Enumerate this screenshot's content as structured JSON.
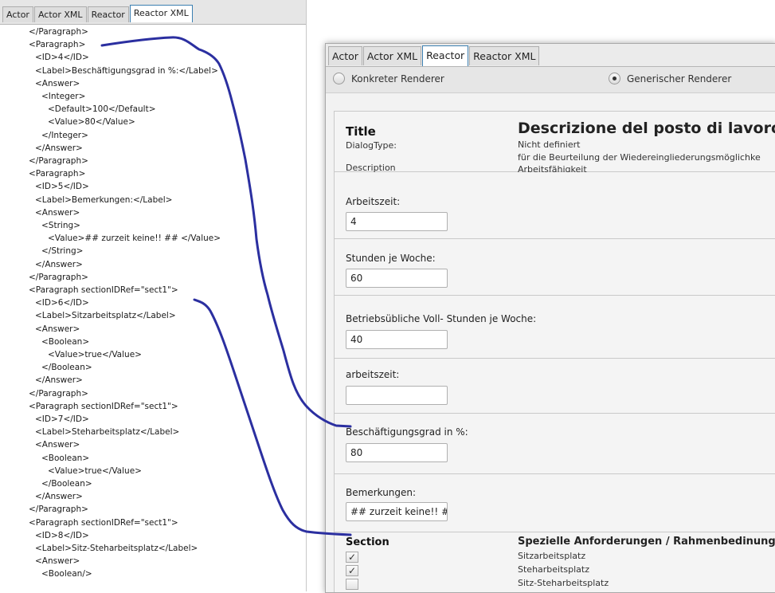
{
  "left_panel": {
    "tabs": [
      "Actor",
      "Actor XML",
      "Reactor",
      "Reactor XML"
    ],
    "active_tab": "Reactor XML",
    "xml_lines": [
      {
        "indent": 0,
        "text": "</Paragraph>"
      },
      {
        "indent": 0,
        "text": "<Paragraph>"
      },
      {
        "indent": 1,
        "text": "<ID>4</ID>"
      },
      {
        "indent": 1,
        "text": "<Label>Beschäftigungsgrad in %:</Label>"
      },
      {
        "indent": 1,
        "text": "<Answer>"
      },
      {
        "indent": 2,
        "text": "<Integer>"
      },
      {
        "indent": 3,
        "text": "<Default>100</Default>"
      },
      {
        "indent": 3,
        "text": "<Value>80</Value>"
      },
      {
        "indent": 2,
        "text": "</Integer>"
      },
      {
        "indent": 1,
        "text": "</Answer>"
      },
      {
        "indent": 0,
        "text": "</Paragraph>"
      },
      {
        "indent": 0,
        "text": "<Paragraph>"
      },
      {
        "indent": 1,
        "text": "<ID>5</ID>"
      },
      {
        "indent": 1,
        "text": "<Label>Bemerkungen:</Label>"
      },
      {
        "indent": 1,
        "text": "<Answer>"
      },
      {
        "indent": 2,
        "text": "<String>"
      },
      {
        "indent": 3,
        "text": "<Value>## zurzeit keine!! ## </Value>"
      },
      {
        "indent": 2,
        "text": "</String>"
      },
      {
        "indent": 1,
        "text": "</Answer>"
      },
      {
        "indent": 0,
        "text": "</Paragraph>"
      },
      {
        "indent": 0,
        "text": "<Paragraph sectionIDRef=\"sect1\">"
      },
      {
        "indent": 1,
        "text": "<ID>6</ID>"
      },
      {
        "indent": 1,
        "text": "<Label>Sitzarbeitsplatz</Label>"
      },
      {
        "indent": 1,
        "text": "<Answer>"
      },
      {
        "indent": 2,
        "text": "<Boolean>"
      },
      {
        "indent": 3,
        "text": "<Value>true</Value>"
      },
      {
        "indent": 2,
        "text": "</Boolean>"
      },
      {
        "indent": 1,
        "text": "</Answer>"
      },
      {
        "indent": 0,
        "text": "</Paragraph>"
      },
      {
        "indent": 0,
        "text": "<Paragraph sectionIDRef=\"sect1\">"
      },
      {
        "indent": 1,
        "text": "<ID>7</ID>"
      },
      {
        "indent": 1,
        "text": "<Label>Steharbeitsplatz</Label>"
      },
      {
        "indent": 1,
        "text": "<Answer>"
      },
      {
        "indent": 2,
        "text": "<Boolean>"
      },
      {
        "indent": 3,
        "text": "<Value>true</Value>"
      },
      {
        "indent": 2,
        "text": "</Boolean>"
      },
      {
        "indent": 1,
        "text": "</Answer>"
      },
      {
        "indent": 0,
        "text": "</Paragraph>"
      },
      {
        "indent": 0,
        "text": "<Paragraph sectionIDRef=\"sect1\">"
      },
      {
        "indent": 1,
        "text": "<ID>8</ID>"
      },
      {
        "indent": 1,
        "text": "<Label>Sitz-Steharbeitsplatz</Label>"
      },
      {
        "indent": 1,
        "text": "<Answer>"
      },
      {
        "indent": 2,
        "text": "<Boolean/>"
      }
    ]
  },
  "right_panel": {
    "tabs": [
      "Actor",
      "Actor XML",
      "Reactor",
      "Reactor XML"
    ],
    "active_tab": "Reactor",
    "renderer_options": {
      "concrete": "Konkreter Renderer",
      "generic": "Generischer Renderer",
      "selected": "generic"
    },
    "header": {
      "title_label": "Title",
      "title_value": "Descrizione del posto di lavoro",
      "dialog_type_label": "DialogType:",
      "dialog_type_value": "Nicht definiert",
      "description_label": "Description",
      "description_line1": "für die Beurteilung der Wiedereingliederungsmöglichke",
      "description_line2": "Arbeitsfähigkeit"
    },
    "fields": [
      {
        "label": "Arbeitszeit:",
        "value": "4"
      },
      {
        "label": "Stunden je Woche:",
        "value": "60"
      },
      {
        "label": "Betriebsübliche Voll- Stunden je Woche:",
        "value": "40"
      },
      {
        "label": "arbeitszeit:",
        "value": ""
      },
      {
        "label": "Beschäftigungsgrad in %:",
        "value": "80"
      },
      {
        "label": "Bemerkungen:",
        "value": "## zurzeit keine!! ##"
      }
    ],
    "section": {
      "label": "Section",
      "title": "Spezielle Anforderungen / Rahmenbedinung",
      "items": [
        {
          "label": "Sitzarbeitsplatz",
          "checked": true
        },
        {
          "label": "Steharbeitsplatz",
          "checked": true
        },
        {
          "label": "Sitz-Steharbeitsplatz",
          "checked": false
        }
      ]
    }
  },
  "colors": {
    "connector_line": "#2b2fa0",
    "active_tab_border": "#3c7fb1"
  }
}
